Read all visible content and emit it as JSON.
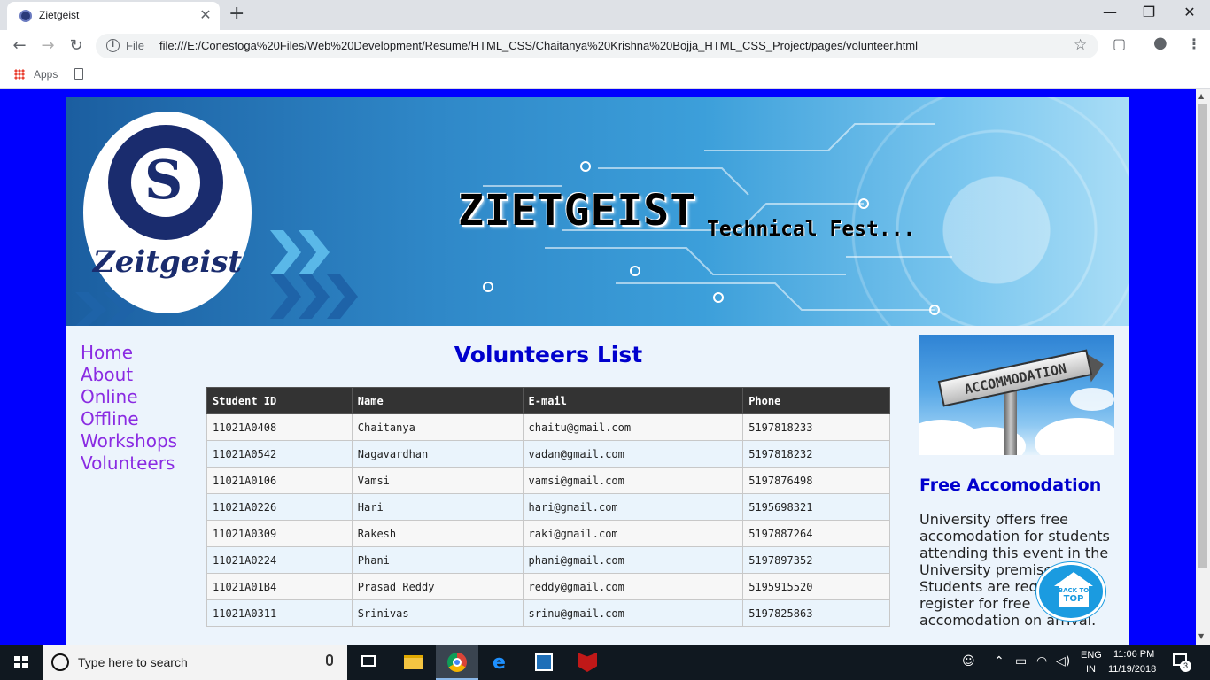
{
  "browser": {
    "tab_title": "Zietgeist",
    "tab_close": "✕",
    "new_tab": "+",
    "scheme_label": "File",
    "url": "file:///E:/Conestoga%20Files/Web%20Development/Resume/HTML_CSS/Chaitanya%20Krishna%20Bojja_HTML_CSS_Project/pages/volunteer.html",
    "bookmarks_apps": "Apps",
    "window_controls": {
      "minimize": "—",
      "maximize": "❐",
      "close": "✕"
    }
  },
  "banner": {
    "logo_text": "Zeitgeist",
    "logo_letter": "S",
    "title": "ZIETGEIST",
    "subtitle": "Technical Fest..."
  },
  "nav": {
    "items": [
      {
        "label": "Home"
      },
      {
        "label": "About"
      },
      {
        "label": "Online"
      },
      {
        "label": "Offline"
      },
      {
        "label": "Workshops"
      },
      {
        "label": "Volunteers"
      }
    ]
  },
  "main": {
    "heading": "Volunteers List",
    "table": {
      "headers": [
        "Student ID",
        "Name",
        "E-mail",
        "Phone"
      ],
      "rows": [
        [
          "11021A0408",
          "Chaitanya",
          "chaitu@gmail.com",
          "5197818233"
        ],
        [
          "11021A0542",
          "Nagavardhan",
          "vadan@gmail.com",
          "5197818232"
        ],
        [
          "11021A0106",
          "Vamsi",
          "vamsi@gmail.com",
          "5197876498"
        ],
        [
          "11021A0226",
          "Hari",
          "hari@gmail.com",
          "5195698321"
        ],
        [
          "11021A0309",
          "Rakesh",
          "raki@gmail.com",
          "5197887264"
        ],
        [
          "11021A0224",
          "Phani",
          "phani@gmail.com",
          "5197897352"
        ],
        [
          "11021A01B4",
          "Prasad Reddy",
          "reddy@gmail.com",
          "5195915520"
        ],
        [
          "11021A0311",
          "Srinivas",
          "srinu@gmail.com",
          "5197825863"
        ]
      ]
    }
  },
  "aside": {
    "image_sign_text": "ACCOMMODATION",
    "heading": "Free Accomodation",
    "text": "University offers free accomodation for students attending this event in the University premises. Students are required to register for free accomodation on arrival."
  },
  "back_to_top": {
    "line1": "BACK TO",
    "line2": "TOP"
  },
  "taskbar": {
    "search_placeholder": "Type here to search",
    "lang_top": "ENG",
    "lang_bottom": "IN",
    "time": "11:06 PM",
    "date": "11/19/2018",
    "notification_count": "3"
  },
  "colors": {
    "page_background": "#0000ff",
    "content_background": "#ecf4fc",
    "nav_link": "#8a2be2",
    "heading": "#0000cd",
    "table_header": "#333333"
  }
}
